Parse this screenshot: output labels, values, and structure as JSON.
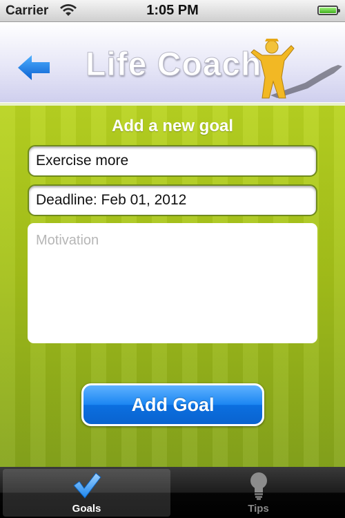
{
  "status_bar": {
    "carrier": "Carrier",
    "time": "1:05 PM",
    "battery_level": 1.0
  },
  "header": {
    "title": "Life Coach",
    "back_icon": "back-arrow-icon",
    "logo_icon": "running-figure-icon"
  },
  "form": {
    "title": "Add a new goal",
    "goal_value": "Exercise more",
    "deadline_value": "Deadline: Feb 01, 2012",
    "motivation_placeholder": "Motivation",
    "submit_label": "Add Goal"
  },
  "tabs": [
    {
      "label": "Goals",
      "icon": "checkmark-icon",
      "selected": true
    },
    {
      "label": "Tips",
      "icon": "lightbulb-icon",
      "selected": false
    }
  ],
  "colors": {
    "accent_blue": "#1b86f2",
    "main_green": "#a6c21a"
  }
}
